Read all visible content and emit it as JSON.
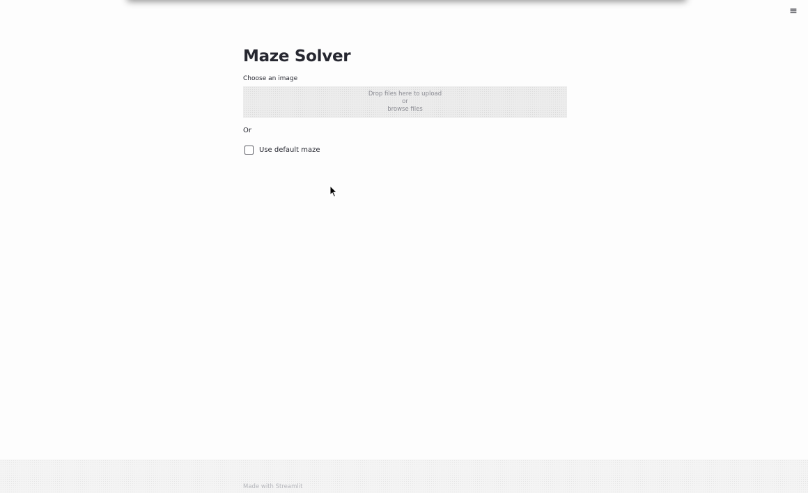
{
  "header": {
    "menu_icon": "hamburger-menu-icon",
    "menu_glyph": "≡"
  },
  "main": {
    "title": "Maze Solver",
    "uploader": {
      "label": "Choose an image",
      "drop_text": "Drop files here to upload",
      "or_text": "or",
      "browse_text": "browse files"
    },
    "or_label": "Or",
    "checkbox": {
      "label": "Use default maze",
      "checked": false
    }
  },
  "footer": {
    "text": "Made with Streamlit"
  },
  "colors": {
    "text": "#262730",
    "background": "#fdfdfd",
    "dropzone": "#ececec"
  }
}
